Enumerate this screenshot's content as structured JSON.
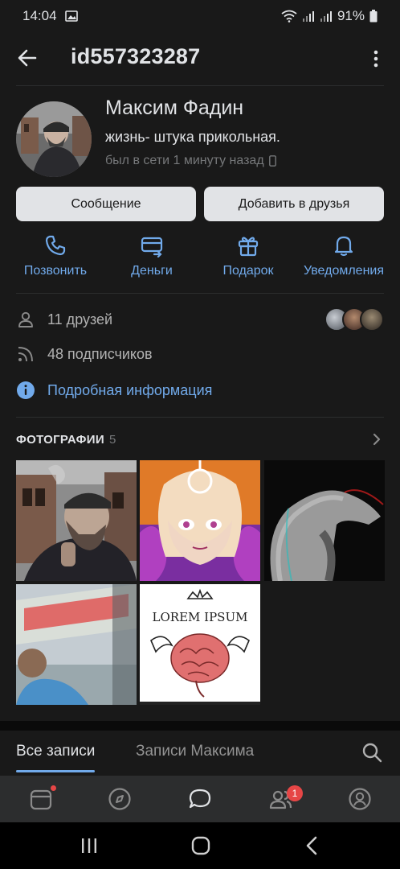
{
  "status_bar": {
    "time": "14:04",
    "battery": "91%"
  },
  "header": {
    "title": "id557323287"
  },
  "profile": {
    "name": "Максим Фадин",
    "status": "жизнь- штука прикольная.",
    "online": "был в сети 1 минуту назад"
  },
  "buttons": {
    "message": "Сообщение",
    "add_friend": "Добавить в друзья"
  },
  "actions": [
    {
      "label": "Позвонить",
      "icon": "phone-icon"
    },
    {
      "label": "Деньги",
      "icon": "money-icon"
    },
    {
      "label": "Подарок",
      "icon": "gift-icon"
    },
    {
      "label": "Уведомления",
      "icon": "bell-icon"
    }
  ],
  "info": {
    "friends": "11 друзей",
    "followers": "48 подписчиков",
    "details": "Подробная информация"
  },
  "photos": {
    "title": "ФОТОГРАФИИ",
    "count": "5",
    "logo_text": "LOREM IPSUM"
  },
  "tabs": {
    "all": "Все записи",
    "own": "Записи Максима"
  },
  "bottom_nav": {
    "friends_badge": "1"
  },
  "colors": {
    "accent": "#71aaeb",
    "background": "#191919",
    "badge": "#e64646"
  }
}
